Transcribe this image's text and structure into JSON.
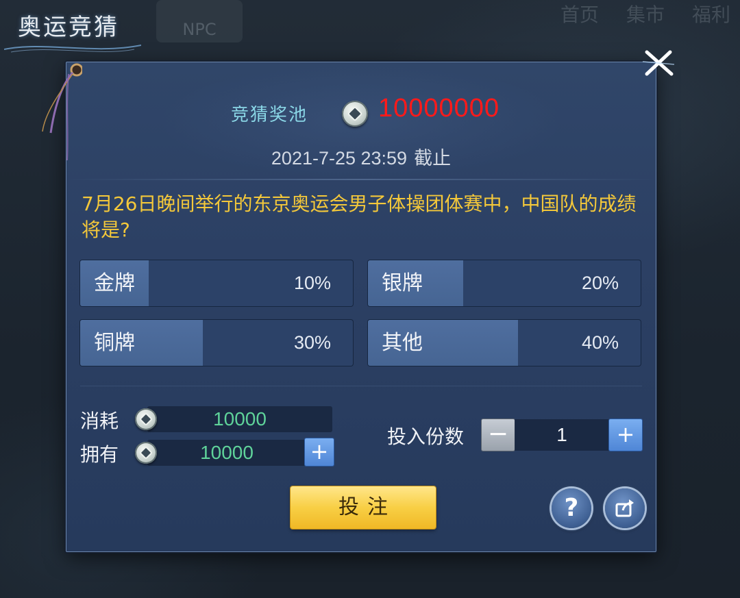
{
  "background": {
    "nav_items": [
      "首页",
      "集市",
      "福利"
    ],
    "npc_label": "NPC"
  },
  "page_title": "奥运竞猜",
  "pool": {
    "label": "竞猜奖池",
    "value": "10000000",
    "value_color": "#ff1a1a"
  },
  "deadline": {
    "time": "2021-7-25 23:59",
    "suffix": "截止"
  },
  "question": "7月26日晚间举行的东京奥运会男子体操团体赛中，中国队的成绩将是?",
  "options": [
    {
      "label": "金牌",
      "percent": "10%",
      "fill": 0.1
    },
    {
      "label": "银牌",
      "percent": "20%",
      "fill": 0.2
    },
    {
      "label": "铜牌",
      "percent": "30%",
      "fill": 0.3
    },
    {
      "label": "其他",
      "percent": "40%",
      "fill": 0.4
    }
  ],
  "cost": {
    "label": "消耗",
    "value": "10000"
  },
  "owned": {
    "label": "拥有",
    "value": "10000",
    "add_label": "+"
  },
  "quantity": {
    "label": "投入份数",
    "value": "1",
    "minus_label": "−",
    "plus_label": "+"
  },
  "bet_button": "投注",
  "help_button": "?",
  "colors": {
    "question": "#f4c83a",
    "value_green": "#5fd39a",
    "bet_button": "#f8cf45",
    "panel": "#2c4064"
  },
  "icons": [
    "coin-icon",
    "close-icon",
    "help-icon",
    "share-icon",
    "plus-icon",
    "minus-icon"
  ]
}
